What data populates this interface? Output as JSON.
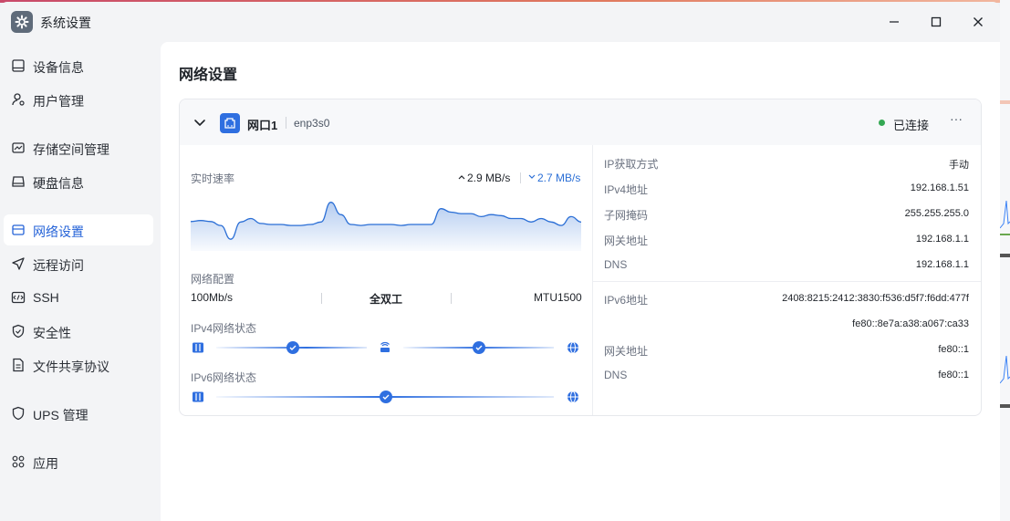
{
  "window": {
    "title": "系统设置",
    "icon": "gear-icon",
    "controls": [
      "minimize-icon",
      "maximize-icon",
      "close-icon"
    ]
  },
  "sidebar": {
    "items": [
      {
        "label": "设备信息",
        "icon": "device-icon",
        "active": false
      },
      {
        "label": "用户管理",
        "icon": "user-icon",
        "active": false
      },
      {
        "label": "存储空间管理",
        "icon": "storage-icon",
        "active": false
      },
      {
        "label": "硬盘信息",
        "icon": "disk-icon",
        "active": false
      },
      {
        "label": "网络设置",
        "icon": "network-icon",
        "active": true
      },
      {
        "label": "远程访问",
        "icon": "remote-icon",
        "active": false
      },
      {
        "label": "SSH",
        "icon": "code-icon",
        "active": false
      },
      {
        "label": "安全性",
        "icon": "shield-icon",
        "active": false
      },
      {
        "label": "文件共享协议",
        "icon": "file-icon",
        "active": false
      },
      {
        "label": "UPS 管理",
        "icon": "ups-icon",
        "active": false
      },
      {
        "label": "应用",
        "icon": "apps-icon",
        "active": false
      }
    ]
  },
  "main": {
    "title": "网络设置",
    "port": {
      "name": "网口1",
      "device": "enp3s0",
      "status": "已连接",
      "status_color": "#34a853",
      "more": "···"
    },
    "realtime": {
      "label": "实时速率",
      "upload": "2.9 MB/s",
      "download": "2.7 MB/s",
      "accent": "#2b6fd6"
    },
    "config": {
      "label": "网络配置",
      "speed": "100Mb/s",
      "duplex": "全双工",
      "mtu": "MTU1500"
    },
    "ipv4_status": {
      "label": "IPv4网络状态"
    },
    "ipv6_status": {
      "label": "IPv6网络状态"
    },
    "ipv4": {
      "rows": [
        {
          "label": "IP获取方式",
          "value": "手动"
        },
        {
          "label": "IPv4地址",
          "value": "192.168.1.51"
        },
        {
          "label": "子网掩码",
          "value": "255.255.255.0"
        },
        {
          "label": "网关地址",
          "value": "192.168.1.1"
        },
        {
          "label": "DNS",
          "value": "192.168.1.1"
        }
      ]
    },
    "ipv6": {
      "rows": [
        {
          "label": "IPv6地址",
          "value": "2408:8215:2412:3830:f536:d5f7:f6dd:477f"
        },
        {
          "label": "",
          "value": "fe80::8e7a:a38:a067:ca33"
        },
        {
          "label": "网关地址",
          "value": "fe80::1"
        },
        {
          "label": "DNS",
          "value": "fe80::1"
        }
      ]
    }
  },
  "chart_data": {
    "type": "area",
    "title": "",
    "xlabel": "",
    "ylabel": "",
    "values": [
      0.56,
      0.58,
      0.56,
      0.48,
      0.2,
      0.55,
      0.62,
      0.52,
      0.5,
      0.5,
      0.48,
      0.48,
      0.5,
      0.55,
      0.95,
      0.7,
      0.5,
      0.48,
      0.5,
      0.5,
      0.5,
      0.48,
      0.5,
      0.5,
      0.5,
      0.82,
      0.75,
      0.72,
      0.72,
      0.66,
      0.7,
      0.68,
      0.62,
      0.62,
      0.55,
      0.62,
      0.55,
      0.48,
      0.66,
      0.55
    ],
    "ylim": [
      0,
      1
    ],
    "color": "#2b6fd6"
  }
}
